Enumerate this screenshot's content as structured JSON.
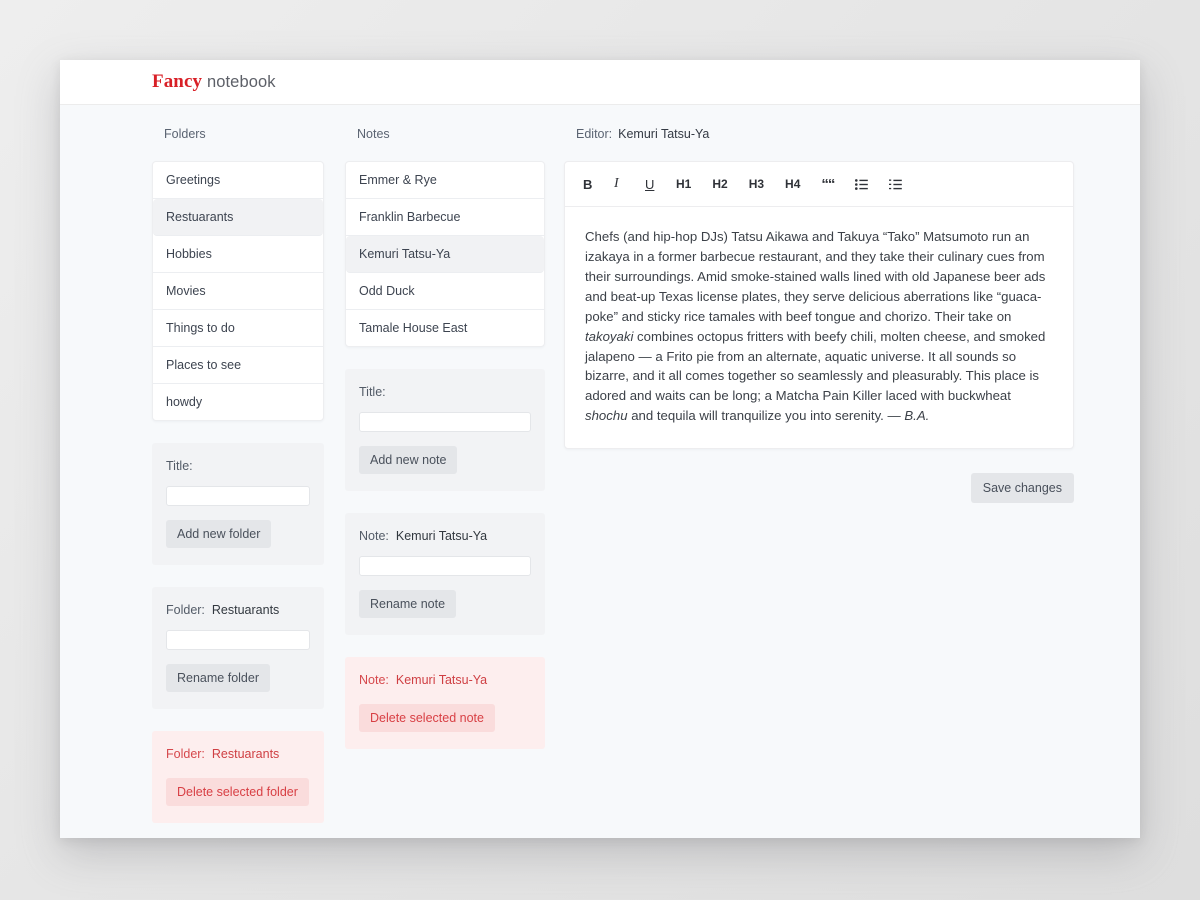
{
  "brand": {
    "primary": "Fancy",
    "secondary": "notebook",
    "accent_color": "#d81f26"
  },
  "columns": {
    "folders": {
      "heading": "Folders"
    },
    "notes": {
      "heading": "Notes"
    },
    "editor": {
      "heading": "Editor:",
      "heading_value": "Kemuri Tatsu-Ya"
    }
  },
  "folders": {
    "items": [
      {
        "label": "Greetings",
        "selected": false
      },
      {
        "label": "Restuarants",
        "selected": true
      },
      {
        "label": "Hobbies",
        "selected": false
      },
      {
        "label": "Movies",
        "selected": false
      },
      {
        "label": "Things to do",
        "selected": false
      },
      {
        "label": "Places to see",
        "selected": false
      },
      {
        "label": "howdy",
        "selected": false
      }
    ],
    "add_panel": {
      "label": "Title:",
      "input_value": "",
      "input_placeholder": "",
      "button": "Add new folder"
    },
    "rename_panel": {
      "label": "Folder:",
      "label_value": "Restuarants",
      "input_value": "",
      "input_placeholder": "",
      "button": "Rename folder"
    },
    "delete_panel": {
      "label": "Folder:",
      "label_value": "Restuarants",
      "button": "Delete selected folder",
      "accent_color": "#d83f44"
    }
  },
  "notes": {
    "items": [
      {
        "label": "Emmer & Rye",
        "selected": false
      },
      {
        "label": "Franklin Barbecue",
        "selected": false
      },
      {
        "label": "Kemuri Tatsu-Ya",
        "selected": true
      },
      {
        "label": "Odd Duck",
        "selected": false
      },
      {
        "label": "Tamale House East",
        "selected": false
      }
    ],
    "add_panel": {
      "label": "Title:",
      "input_value": "",
      "input_placeholder": "",
      "button": "Add new note"
    },
    "rename_panel": {
      "label": "Note:",
      "label_value": "Kemuri Tatsu-Ya",
      "input_value": "",
      "input_placeholder": "",
      "button": "Rename note"
    },
    "delete_panel": {
      "label": "Note:",
      "label_value": "Kemuri Tatsu-Ya",
      "button": "Delete selected note",
      "accent_color": "#d83f44"
    }
  },
  "editor": {
    "toolbar": [
      {
        "name": "bold",
        "label": "B"
      },
      {
        "name": "italic",
        "label": "I"
      },
      {
        "name": "underline",
        "label": "U"
      },
      {
        "name": "heading-1",
        "label": "H1"
      },
      {
        "name": "heading-2",
        "label": "H2"
      },
      {
        "name": "heading-3",
        "label": "H3"
      },
      {
        "name": "heading-4",
        "label": "H4"
      },
      {
        "name": "blockquote",
        "label": "““"
      },
      {
        "name": "bullet-list",
        "label": ""
      },
      {
        "name": "numbered-list",
        "label": ""
      }
    ],
    "content_parts": [
      {
        "text": "Chefs (and hip-hop DJs) Tatsu Aikawa and Takuya “Tako” Matsumoto run an izakaya in a former barbecue restaurant, and they take their culinary cues from their surroundings. Amid smoke-stained walls lined with old Japanese beer ads and beat-up Texas license plates, they serve delicious aberrations like “guaca-poke” and sticky rice tamales with beef tongue and chorizo. Their take on ",
        "style": "normal"
      },
      {
        "text": "takoyaki",
        "style": "italic"
      },
      {
        "text": " combines octopus fritters with beefy chili, molten cheese, and smoked jalapeno — a Frito pie from an alternate, aquatic universe. It all sounds so bizarre, and it all comes together so seamlessly and pleasurably. This place is adored and waits can be long; a Matcha Pain Killer laced with buckwheat ",
        "style": "normal"
      },
      {
        "text": "shochu",
        "style": "italic"
      },
      {
        "text": " and tequila will tranquilize you into serenity. — ",
        "style": "normal"
      },
      {
        "text": "B.A.",
        "style": "italic"
      }
    ],
    "save_button": "Save changes"
  }
}
